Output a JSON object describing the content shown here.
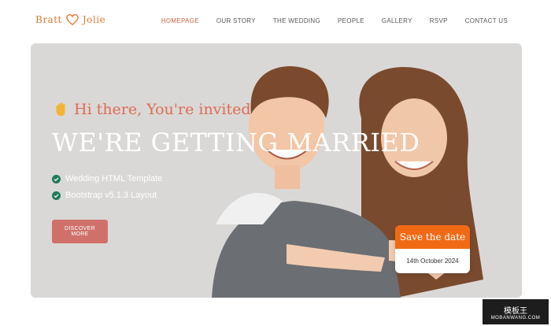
{
  "brand": {
    "left": "Bratt",
    "right": "Jolie"
  },
  "nav": [
    {
      "label": "HOMEPAGE",
      "active": true
    },
    {
      "label": "OUR STORY",
      "active": false
    },
    {
      "label": "THE WEDDING",
      "active": false
    },
    {
      "label": "PEOPLE",
      "active": false
    },
    {
      "label": "GALLERY",
      "active": false
    },
    {
      "label": "RSVP",
      "active": false
    },
    {
      "label": "CONTACT US",
      "active": false
    }
  ],
  "hero": {
    "greeting": "Hi there, You're invited",
    "title": "WE'RE GETTING MARRIED",
    "features": [
      "Wedding HTML Template",
      "Bootstrap v5.1.3 Layout"
    ],
    "cta": "DISCOVER MORE"
  },
  "save_date": {
    "title": "Save the date",
    "date": "14th October 2024"
  },
  "watermark": {
    "title": "模板王",
    "subtitle": "MOBANWANG.COM"
  },
  "colors": {
    "accent": "#d4624d",
    "orange": "#f06a16",
    "button": "#d0706a",
    "hero_bg": "#dad8d6"
  }
}
